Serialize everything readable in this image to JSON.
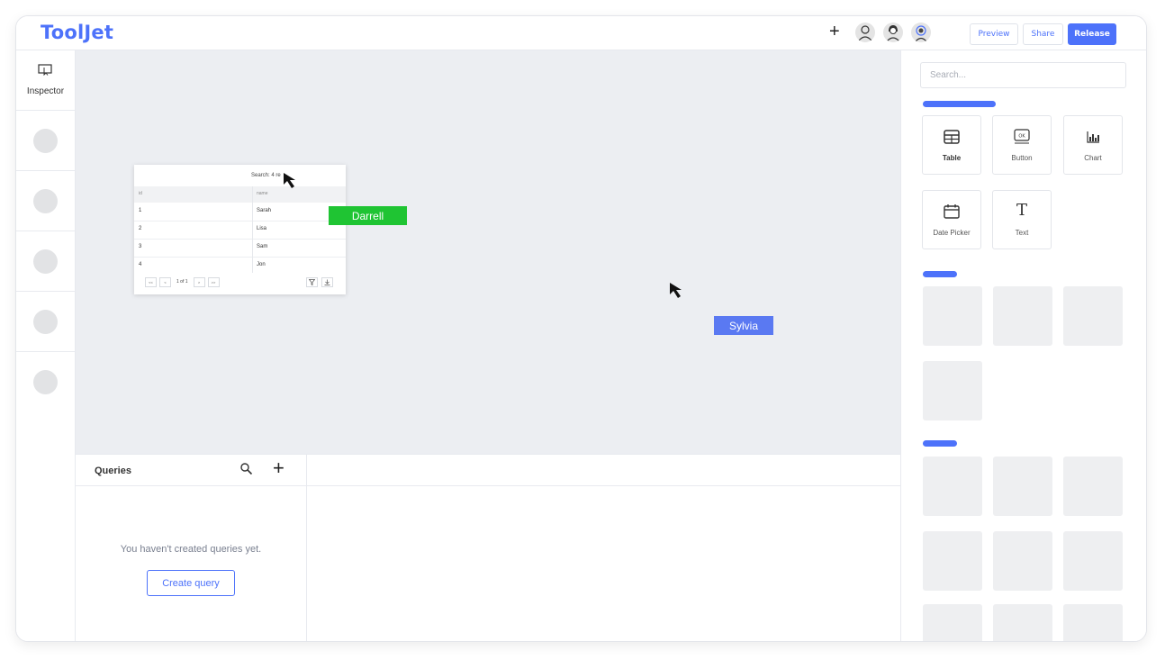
{
  "app": {
    "logo": "ToolJet"
  },
  "header": {
    "preview_label": "Preview",
    "share_label": "Share",
    "release_label": "Release",
    "colors": {
      "accent": "#4d72fa"
    }
  },
  "sidebar": {
    "inspector_label": "Inspector"
  },
  "table_widget": {
    "search_label": "Search:",
    "search_value": "4 re",
    "columns": [
      "id",
      "name"
    ],
    "rows": [
      {
        "id": "1",
        "name": "Sarah"
      },
      {
        "id": "2",
        "name": "Lisa"
      },
      {
        "id": "3",
        "name": "Sam"
      },
      {
        "id": "4",
        "name": "Jon"
      }
    ],
    "pager": {
      "first": "<<",
      "prev": "<",
      "page_text": "1 of 1",
      "next": ">",
      "last": ">>"
    }
  },
  "collaborators": [
    {
      "name": "Darrell",
      "color": "#1fc433"
    },
    {
      "name": "Sylvia",
      "color": "#5a79f2"
    }
  ],
  "queries": {
    "title": "Queries",
    "empty_text": "You haven't created queries yet.",
    "create_label": "Create query"
  },
  "components_panel": {
    "search_placeholder": "Search...",
    "components": [
      {
        "label": "Table",
        "icon": "table-icon"
      },
      {
        "label": "Button",
        "icon": "button-icon"
      },
      {
        "label": "Chart",
        "icon": "chart-icon"
      },
      {
        "label": "Date Picker",
        "icon": "calendar-icon"
      },
      {
        "label": "Text",
        "icon": "text-icon"
      }
    ]
  }
}
